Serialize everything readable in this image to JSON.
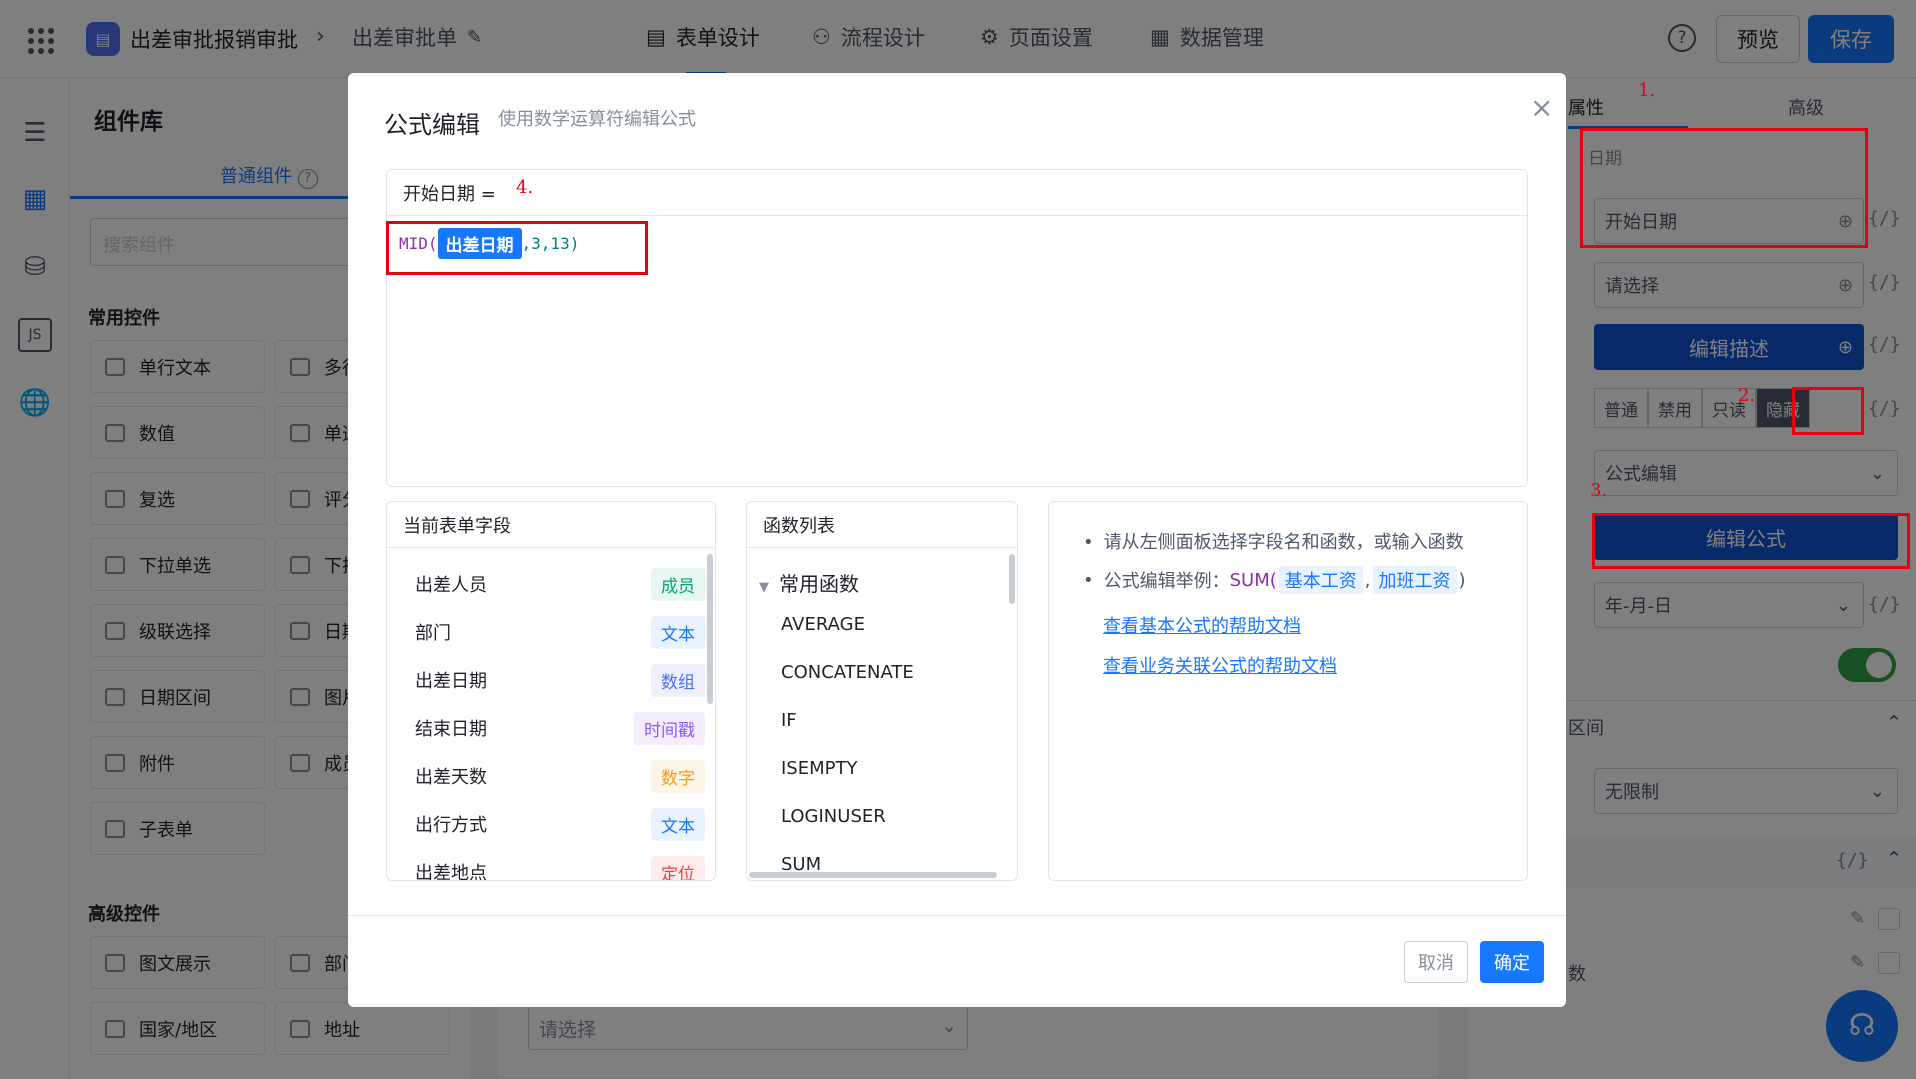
{
  "topbar": {
    "app_title": "出差审批报销审批",
    "breadcrumb_current": "出差审批单",
    "tabs": [
      {
        "label": "表单设计",
        "icon": "document-icon"
      },
      {
        "label": "流程设计",
        "icon": "flow-icon"
      },
      {
        "label": "页面设置",
        "icon": "gear-icon"
      },
      {
        "label": "数据管理",
        "icon": "table-icon"
      }
    ],
    "preview_label": "预览",
    "save_label": "保存"
  },
  "library": {
    "title": "组件库",
    "tab_common": "普通组件",
    "search_placeholder": "搜索组件",
    "section_common": "常用控件",
    "common_items": [
      "单行文本",
      "多行",
      "数值",
      "单选",
      "复选",
      "评分",
      "下拉单选",
      "下拉",
      "级联选择",
      "日期",
      "日期区间",
      "图片",
      "附件",
      "成员",
      "子表单"
    ],
    "section_advanced": "高级控件",
    "advanced_items": [
      "图文展示",
      "部门",
      "国家/地区",
      "地址"
    ]
  },
  "rightpanel": {
    "tab_props": "属性",
    "tab_advanced": "高级",
    "field_type": "日期",
    "title_value": "开始日期",
    "placeholder_value": "请选择",
    "edit_desc": "编辑描述",
    "states": [
      "普通",
      "禁用",
      "只读",
      "隐藏"
    ],
    "default_mode": "公式编辑",
    "edit_formula": "编辑公式",
    "date_format": "年-月-日",
    "section_range": "区间",
    "range_value": "无限制",
    "fx": "{/}",
    "bottom_text": "数",
    "annotations": [
      "1.",
      "2.",
      "3.",
      "4."
    ]
  },
  "canvas": {
    "select_placeholder": "请选择"
  },
  "dialog": {
    "title": "公式编辑",
    "subtitle": "使用数学运算符编辑公式",
    "formula_target": "开始日期 =",
    "formula_func": "MID(",
    "formula_field": "出差日期",
    "formula_args": ",3,13)",
    "fields_title": "当前表单字段",
    "fields": [
      {
        "name": "出差人员",
        "type": "成员",
        "color": "#00a870",
        "bg": "#e8f8f0"
      },
      {
        "name": "部门",
        "type": "文本",
        "color": "#1677ff",
        "bg": "#e8f3ff"
      },
      {
        "name": "出差日期",
        "type": "数组",
        "color": "#4e6ef2",
        "bg": "#eef1fd"
      },
      {
        "name": "结束日期",
        "type": "时间戳",
        "color": "#8b5cf6",
        "bg": "#f3edfe"
      },
      {
        "name": "出差天数",
        "type": "数字",
        "color": "#f59a23",
        "bg": "#fff5e6"
      },
      {
        "name": "出行方式",
        "type": "文本",
        "color": "#1677ff",
        "bg": "#e8f3ff"
      },
      {
        "name": "出差地点",
        "type": "定位",
        "color": "#f53f3f",
        "bg": "#ffecec"
      }
    ],
    "functions_title": "函数列表",
    "function_group": "常用函数",
    "functions": [
      "AVERAGE",
      "CONCATENATE",
      "IF",
      "ISEMPTY",
      "LOGINUSER",
      "SUM"
    ],
    "tips": {
      "tip1": "请从左侧面板选择字段名和函数，或输入函数",
      "tip2_prefix": "公式编辑举例：",
      "tip2_func": "SUM(",
      "tip2_arg1": "基本工资",
      "tip2_sep": ",",
      "tip2_arg2": "加班工资",
      "tip2_suffix": ")",
      "link1": "查看基本公式的帮助文档",
      "link2": "查看业务关联公式的帮助文档"
    },
    "cancel": "取消",
    "confirm": "确定"
  }
}
